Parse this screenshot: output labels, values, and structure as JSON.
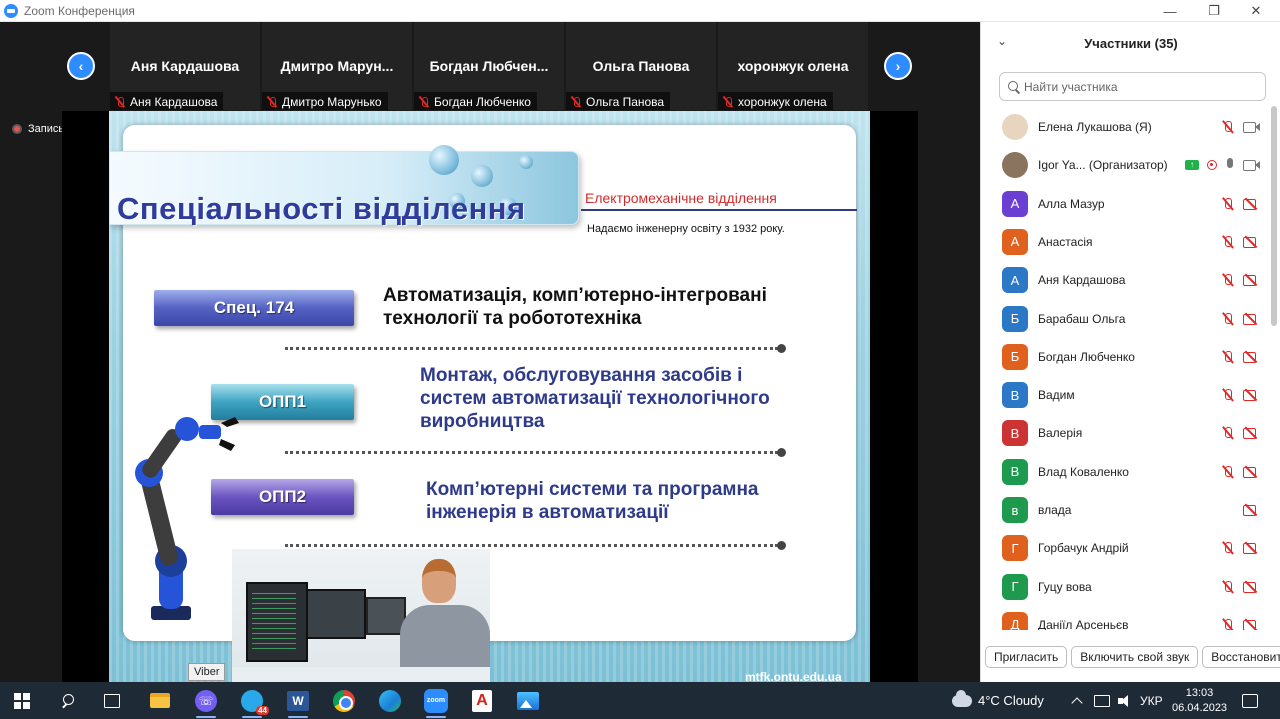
{
  "window": {
    "title": "Zoom Конференция",
    "controls": {
      "minimize": "—",
      "maximize": "❐",
      "close": "✕"
    }
  },
  "gallery": {
    "tiles": [
      {
        "name": "Аня Кардашова",
        "label": "Аня Кардашова"
      },
      {
        "name": "Дмитро  Марун...",
        "label": "Дмитро Марунько"
      },
      {
        "name": "Богдан  Любчен...",
        "label": "Богдан Любченко"
      },
      {
        "name": "Ольга Панова",
        "label": "Ольга Панова"
      },
      {
        "name": "хоронжук олена",
        "label": "хоронжук олена"
      }
    ]
  },
  "recording": {
    "label": "Запись"
  },
  "slide": {
    "title": "Спеціальності відділення",
    "department": "Електромеханічне відділення",
    "since": "Надаємо інженерну освіту з 1932 року.",
    "specs": [
      {
        "code": "Спец. 174",
        "line1": "Автоматизація, комп’ютерно-інтегровані",
        "line2": "технології та робототехніка",
        "line3": ""
      },
      {
        "code": "ОПП1",
        "line1": "Монтаж, обслуговування засобів і",
        "line2": "систем автоматизації технологічного",
        "line3": "виробництва"
      },
      {
        "code": "ОПП2",
        "line1": "Комп’ютерні системи та програмна",
        "line2": "інженерія в автоматизації",
        "line3": ""
      }
    ],
    "url": "mtfk.ontu.edu.ua"
  },
  "participants": {
    "title": "Участники (35)",
    "search_placeholder": "Найти участника",
    "list": [
      {
        "initial": "",
        "name": "Елена Лукашова (Я)",
        "color": "#e8d5c0",
        "photo": true,
        "mic": "off",
        "cam": "on"
      },
      {
        "initial": "",
        "name": "Igor Ya...  (Организатор)",
        "color": "#8a7460",
        "photo": true,
        "mic": "on",
        "cam": "on",
        "host": true
      },
      {
        "initial": "А",
        "name": "Алла Мазур",
        "color": "#6a3fd2",
        "mic": "off",
        "cam": "off"
      },
      {
        "initial": "А",
        "name": "Анастасія",
        "color": "#e0611e",
        "mic": "off",
        "cam": "off"
      },
      {
        "initial": "А",
        "name": "Аня Кардашова",
        "color": "#2a78c6",
        "mic": "off",
        "cam": "off"
      },
      {
        "initial": "Б",
        "name": "Барабаш Ольга",
        "color": "#2a78c6",
        "mic": "off",
        "cam": "off"
      },
      {
        "initial": "Б",
        "name": "Богдан Любченко",
        "color": "#e0611e",
        "mic": "off",
        "cam": "off"
      },
      {
        "initial": "В",
        "name": "Вадим",
        "color": "#2a78c6",
        "mic": "off",
        "cam": "off"
      },
      {
        "initial": "В",
        "name": "Валерія",
        "color": "#cc3333",
        "mic": "off",
        "cam": "off"
      },
      {
        "initial": "В",
        "name": "Влад Коваленко",
        "color": "#1e9a4f",
        "mic": "off",
        "cam": "off"
      },
      {
        "initial": "в",
        "name": "влада",
        "color": "#1e9a4f",
        "mic": "",
        "cam": "off"
      },
      {
        "initial": "Г",
        "name": "Горбачук Андрій",
        "color": "#e0611e",
        "mic": "off",
        "cam": "off"
      },
      {
        "initial": "Г",
        "name": "Гуцу вова",
        "color": "#1e9a4f",
        "mic": "off",
        "cam": "off"
      },
      {
        "initial": "Д",
        "name": "Даніїл Арсеньєв",
        "color": "#e0611e",
        "mic": "off",
        "cam": "off"
      }
    ],
    "footer": {
      "invite": "Пригласить",
      "unmute": "Включить свой звук",
      "restore": "Восстановить"
    }
  },
  "taskbar": {
    "tooltip": "Viber",
    "telegram_badge": "44",
    "word_letter": "W",
    "zoom_label": "zoom",
    "weather": "4°C  Cloudy",
    "language": "УКР",
    "time": "13:03",
    "date": "06.04.2023"
  },
  "colors": {
    "accent": "#2d8cff",
    "muted": "#e02828",
    "slide_title": "#2f3c9c",
    "department": "#d12c2c"
  }
}
